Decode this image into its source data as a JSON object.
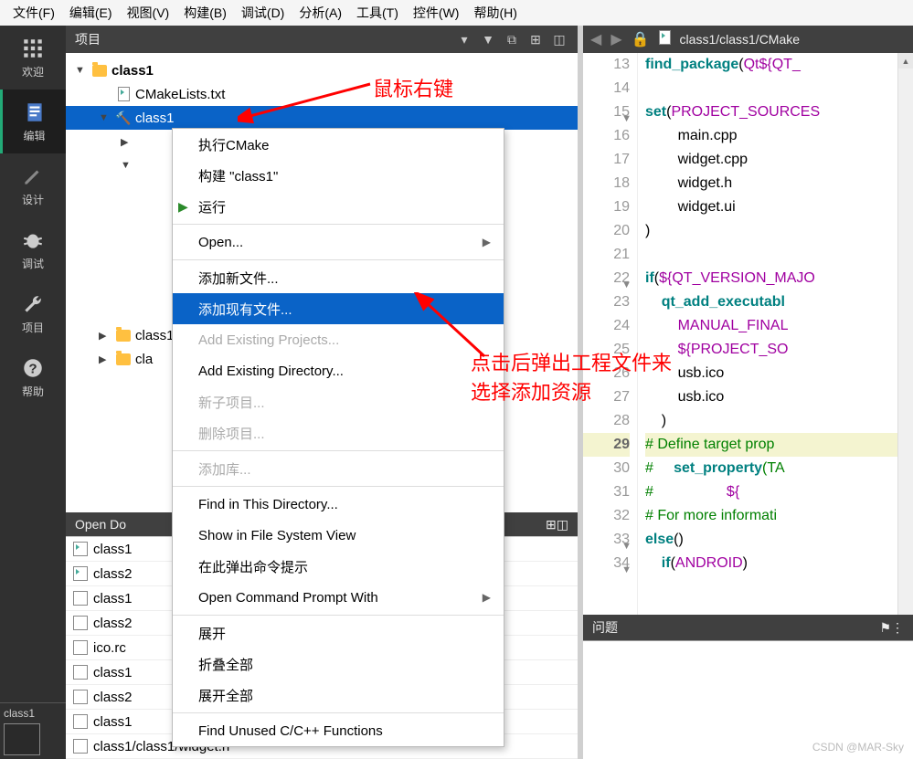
{
  "menubar": {
    "file": "文件(F)",
    "edit": "编辑(E)",
    "view": "视图(V)",
    "build": "构建(B)",
    "debug": "调试(D)",
    "analyze": "分析(A)",
    "tools": "工具(T)",
    "widgets": "控件(W)",
    "help": "帮助(H)"
  },
  "leftbar": {
    "welcome": "欢迎",
    "edit": "编辑",
    "design": "设计",
    "debug": "调试",
    "project": "项目",
    "help": "帮助",
    "build_target": "class1"
  },
  "project_pane": {
    "title": "项目"
  },
  "tree": {
    "root": "class1",
    "cmake": "CMakeLists.txt",
    "target": "class1",
    "sub_a": "class1",
    "sub_b": "cla"
  },
  "context_menu": {
    "run_cmake": "执行CMake",
    "build": "构建 \"class1\"",
    "run": "运行",
    "open": "Open...",
    "add_new": "添加新文件...",
    "add_existing": "添加现有文件...",
    "add_proj": "Add Existing Projects...",
    "add_dir": "Add Existing Directory...",
    "new_sub": "新子项目...",
    "del_proj": "删除项目...",
    "add_lib": "添加库...",
    "find_dir": "Find in This Directory...",
    "show_fs": "Show in File System View",
    "term_here": "在此弹出命令提示",
    "cmd_prompt": "Open Command Prompt With",
    "expand": "展开",
    "collapse_all": "折叠全部",
    "expand_all": "展开全部",
    "find_unused": "Find Unused C/C++ Functions"
  },
  "open_docs": {
    "title": "Open Do",
    "items": [
      "class1",
      "class2",
      "class1",
      "class2",
      "ico.rc",
      "class1",
      "class2",
      "class1",
      "class1/class1/widget.h"
    ]
  },
  "editor": {
    "path": "class1/class1/CMake",
    "lines": [
      {
        "n": 13,
        "t": "find_package(Qt${QT_"
      },
      {
        "n": 14,
        "t": ""
      },
      {
        "n": 15,
        "t": "set(PROJECT_SOURCES"
      },
      {
        "n": 16,
        "t": "        main.cpp"
      },
      {
        "n": 17,
        "t": "        widget.cpp"
      },
      {
        "n": 18,
        "t": "        widget.h"
      },
      {
        "n": 19,
        "t": "        widget.ui"
      },
      {
        "n": 20,
        "t": ")"
      },
      {
        "n": 21,
        "t": ""
      },
      {
        "n": 22,
        "t": "if(${QT_VERSION_MAJO"
      },
      {
        "n": 23,
        "t": "    qt_add_executabl"
      },
      {
        "n": 24,
        "t": "        MANUAL_FINAL"
      },
      {
        "n": 25,
        "t": "        ${PROJECT_SO"
      },
      {
        "n": 26,
        "t": "        usb.ico"
      },
      {
        "n": 27,
        "t": "        usb.ico"
      },
      {
        "n": 28,
        "t": "    )"
      },
      {
        "n": 29,
        "t": "# Define target prop"
      },
      {
        "n": 30,
        "t": "#     set_property(TA"
      },
      {
        "n": 31,
        "t": "#                  ${"
      },
      {
        "n": 32,
        "t": "# For more informati"
      },
      {
        "n": 33,
        "t": "else()"
      },
      {
        "n": 34,
        "t": "    if(ANDROID)"
      }
    ],
    "current_line": 29
  },
  "problems": {
    "title": "问题"
  },
  "annotations": {
    "a1": "鼠标右键",
    "a2": "点击后弹出工程文件来",
    "a3": "选择添加资源"
  },
  "watermark": "CSDN @MAR-Sky"
}
